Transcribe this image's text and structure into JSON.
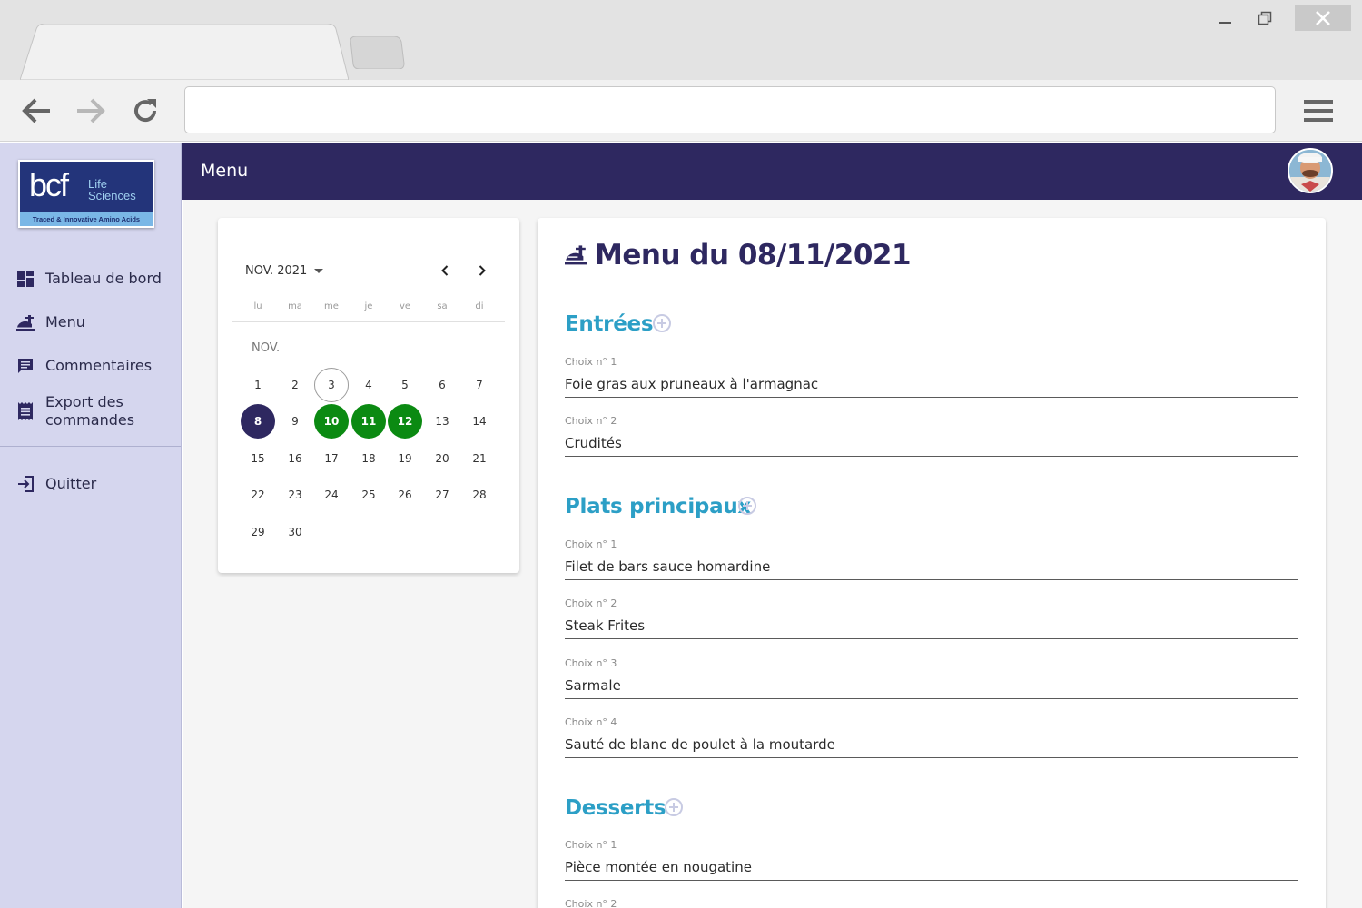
{
  "browser": {
    "url": ""
  },
  "logo": {
    "brand": "bcf",
    "tagline_line1": "Life",
    "tagline_line2": "Sciences",
    "band": "Traced & Innovative Amino Acids"
  },
  "sidebar": {
    "items": [
      {
        "label": "Tableau de bord",
        "icon": "dashboard-icon"
      },
      {
        "label": "Menu",
        "icon": "room-service-icon"
      },
      {
        "label": "Commentaires",
        "icon": "comment-icon"
      },
      {
        "label": "Export des commandes",
        "icon": "receipt-icon"
      },
      {
        "label": "Quitter",
        "icon": "exit-icon"
      }
    ]
  },
  "header": {
    "title": "Menu"
  },
  "calendar": {
    "month_label": "NOV. 2021",
    "weekdays": [
      "lu",
      "ma",
      "me",
      "je",
      "ve",
      "sa",
      "di"
    ],
    "month_short": "NOV.",
    "today": 3,
    "selected": 8,
    "highlighted": [
      10,
      11,
      12
    ],
    "days_in_month": 30,
    "first_weekday_index": 0,
    "colors": {
      "selected": "#2e2860",
      "highlighted": "#0b8a12"
    }
  },
  "menu": {
    "title": "Menu du 08/11/2021",
    "sections": [
      {
        "title": "Entrées",
        "choices": [
          {
            "label": "Choix n° 1",
            "value": "Foie gras aux pruneaux à l'armagnac"
          },
          {
            "label": "Choix n° 2",
            "value": "Crudités"
          }
        ]
      },
      {
        "title": "Plats principaux",
        "choices": [
          {
            "label": "Choix n° 1",
            "value": "Filet de bars sauce homardine"
          },
          {
            "label": "Choix n° 2",
            "value": "Steak Frites"
          },
          {
            "label": "Choix n° 3",
            "value": "Sarmale"
          },
          {
            "label": "Choix n° 4",
            "value": "Sauté de blanc de poulet à la moutarde"
          }
        ]
      },
      {
        "title": "Desserts",
        "choices": [
          {
            "label": "Choix n° 1",
            "value": "Pièce montée en nougatine"
          },
          {
            "label": "Choix n° 2",
            "value": ""
          }
        ]
      }
    ]
  },
  "colors": {
    "primary": "#2e2860",
    "section": "#2c9fc6",
    "sidebar_bg": "#d5d6ee"
  }
}
